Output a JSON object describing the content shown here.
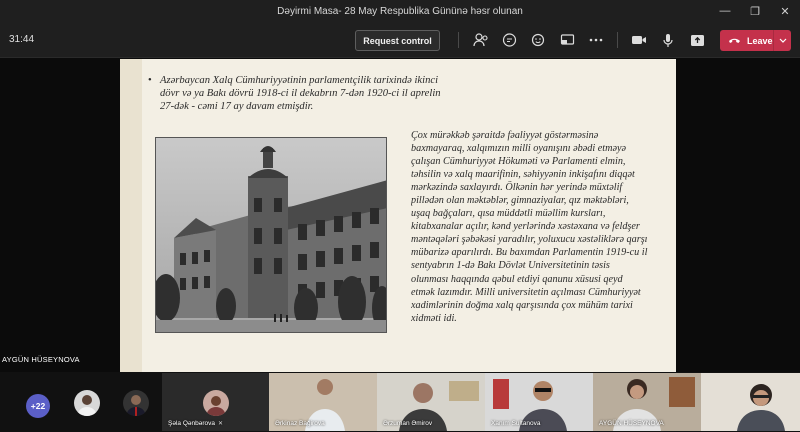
{
  "window": {
    "title": "Dəyirmi Masa- 28 May Respublika Gününə həsr olunan",
    "controls": [
      "—",
      "❐",
      "✕"
    ]
  },
  "toolbar": {
    "timer": "31:44",
    "request_control_label": "Request control",
    "leave_label": "Leave",
    "leave_color": "#c4314b",
    "icons": [
      "people-icon",
      "chat-icon",
      "reactions-icon",
      "share-tray-icon",
      "more-icon",
      "camera-icon",
      "mic-icon",
      "share-icon"
    ]
  },
  "slide": {
    "bullet": "Azərbaycan Xalq Cümhuriyyətinin parlamentçilik tarixində ikinci dövr və ya Bakı dövrü 1918-ci il dekabrın 7-dən 1920-ci il aprelin 27-dək - cəmi 17 ay davam etmişdir.",
    "paragraph_lines": [
      "Çox mürəkkəb şəraitdə fəaliyyət göstərməsinə",
      "baxmayaraq, xalqımızın milli oyanışını əbədi etməyə",
      "çalışan Cümhuriyyət Hökuməti və Parlamenti elmin,",
      "təhsilin və xalq maarifinin, səhiyyənin inkişafını diqqət",
      "mərkəzində saxlayırdı. Ölkənin hər yerində müxtəlif",
      "pillədən olan məktəblər, gimnaziyalar, qız məktəbləri,",
      "uşaq bağçaları, qısa müddətli müəllim kursları,",
      "kitabxanalar açılır, kənd yerlərində xəstəxana və feldşer",
      "məntəqələri şəbəkəsi yaradılır, yoluxucu xəstəliklərə qarşı",
      "mübarizə aparılırdı. Bu baxımdan Parlamentin 1919-cu il",
      "sentyabrın 1-də Bakı Dövlət Universitetinin təsis",
      "olunması haqqında qəbul etdiyi qanunu xüsusi qeyd",
      "etmək lazımdır. Milli universitetin açılması Cümhuriyyət",
      "xadimlərinin doğma xalq qarşısında çox mühüm tarixi",
      "xidməti idi."
    ]
  },
  "presenter_name": "AYGÜN HÜSEYNOVA",
  "gallery": {
    "overflow_count": "+22",
    "overflow_color": "#5b5fc7",
    "named_participant": "Şəla Qənbərova",
    "tiles": [
      {
        "name": "Ərkinaz Bağirova"
      },
      {
        "name": "Ərzuman Əmirov"
      },
      {
        "name": "Xanım Sultanova"
      },
      {
        "name": "AYGÜN HÜSEYNOVA"
      },
      {
        "name": ""
      }
    ]
  }
}
